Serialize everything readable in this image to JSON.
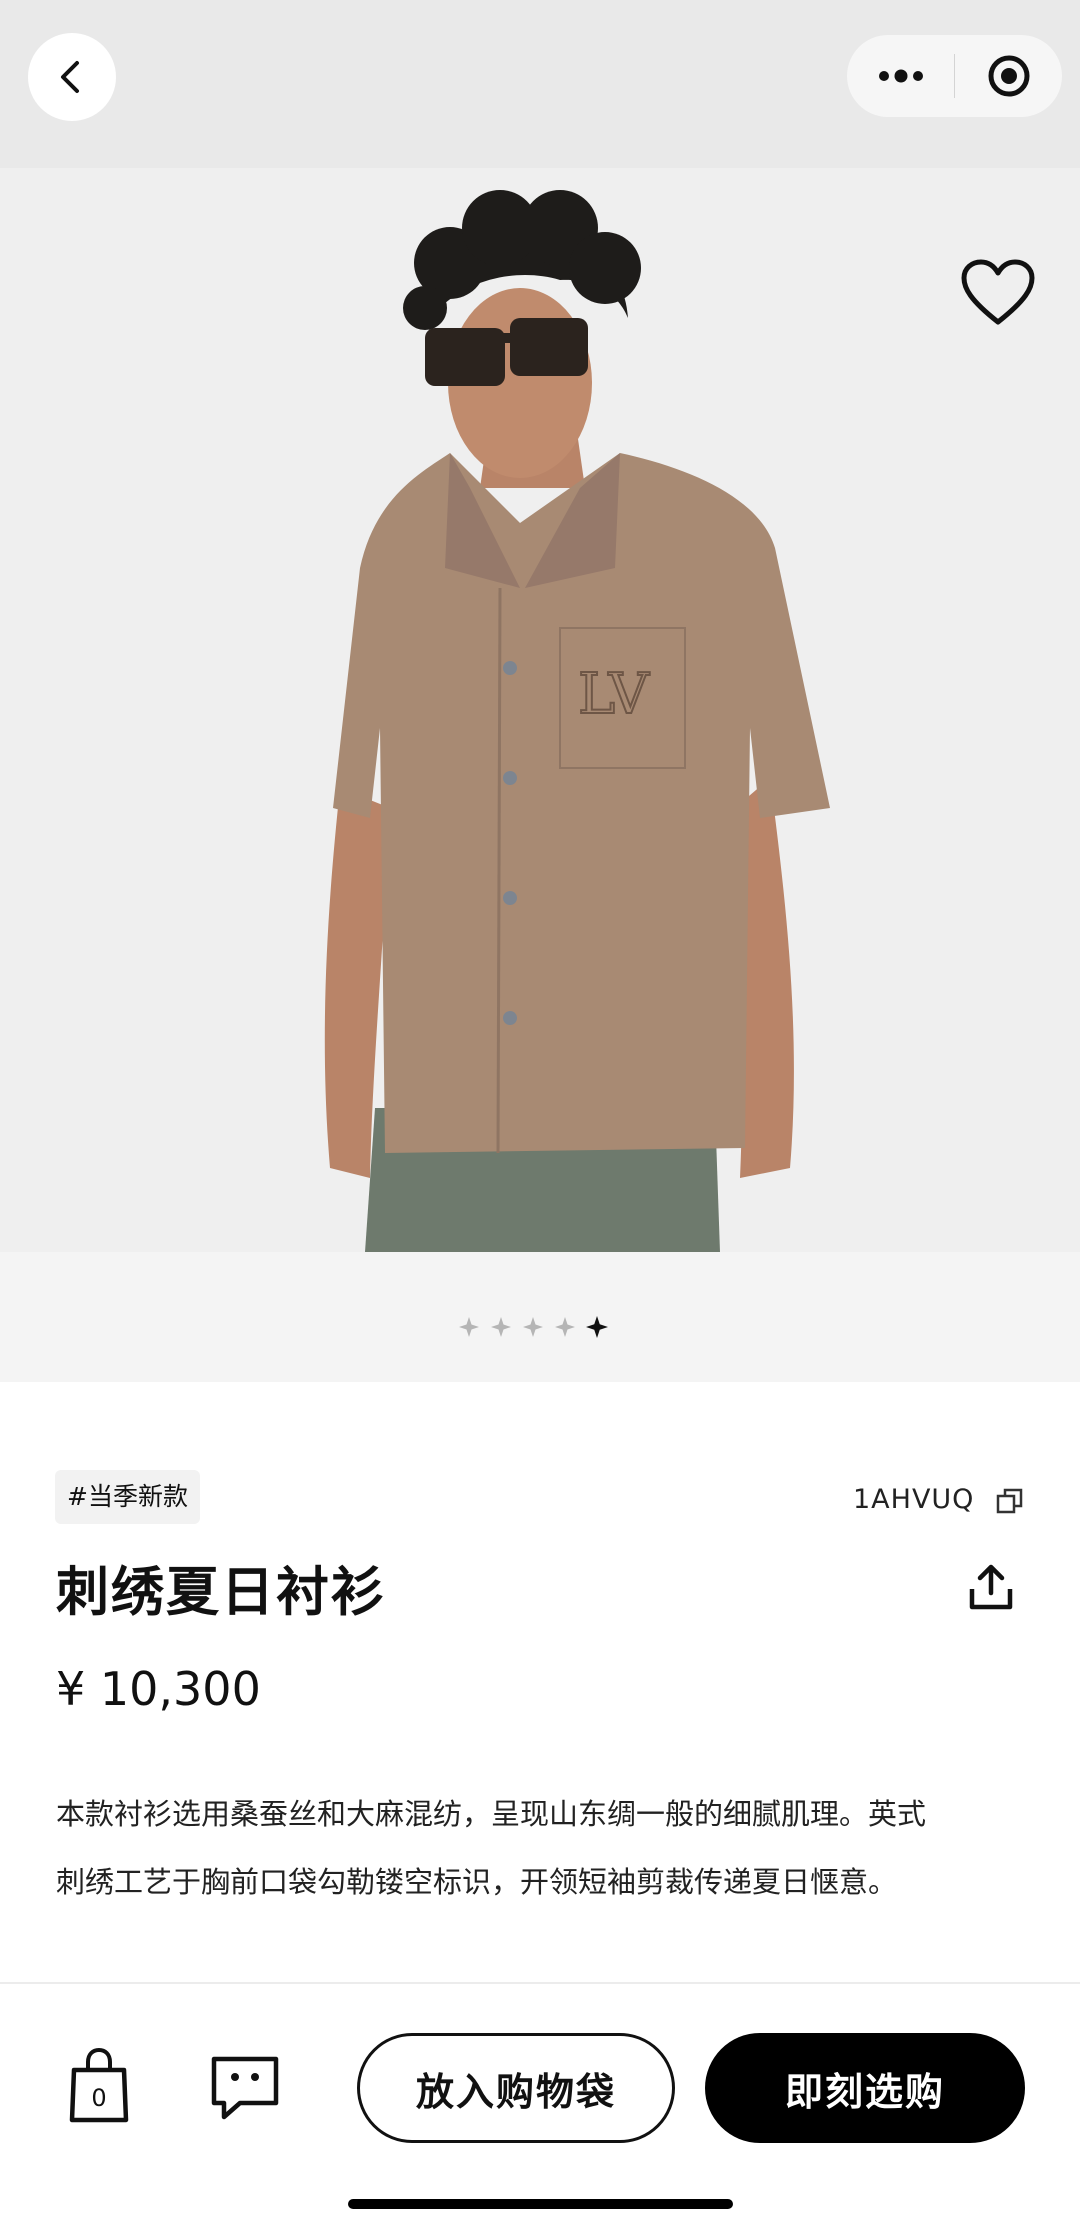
{
  "header": {
    "back_icon": "chevron-left-icon",
    "more_icon": "more-dots-icon",
    "target_icon": "target-circle-icon"
  },
  "gallery": {
    "image_label": "model wearing embroidered summer shirt",
    "image_count": 5,
    "active_index": 4,
    "favorite_icon": "heart-outline-icon"
  },
  "product": {
    "tag": "#当季新款",
    "sku": "1AHVUQ",
    "copy_icon": "copy-icon",
    "title": "刺绣夏日衬衫",
    "share_icon": "share-icon",
    "price": "¥ 10,300",
    "description_lines": [
      "本款衬衫选用桑蚕丝和大麻混纺，呈现山东绸一般的细腻肌理。英式",
      "刺绣工艺于胸前口袋勾勒镂空标识，开领短袖剪裁传递夏日惬意。"
    ]
  },
  "bottom_bar": {
    "bag_icon": "shopping-bag-icon",
    "bag_count": "0",
    "chat_icon": "chat-bubble-icon",
    "add_to_bag_label": "放入购物袋",
    "buy_now_label": "即刻选购"
  },
  "colors": {
    "topbar": "#e9e9e9",
    "shirt": "#a88a73",
    "pants": "#6e7a6d",
    "primary_button": "#000000"
  }
}
